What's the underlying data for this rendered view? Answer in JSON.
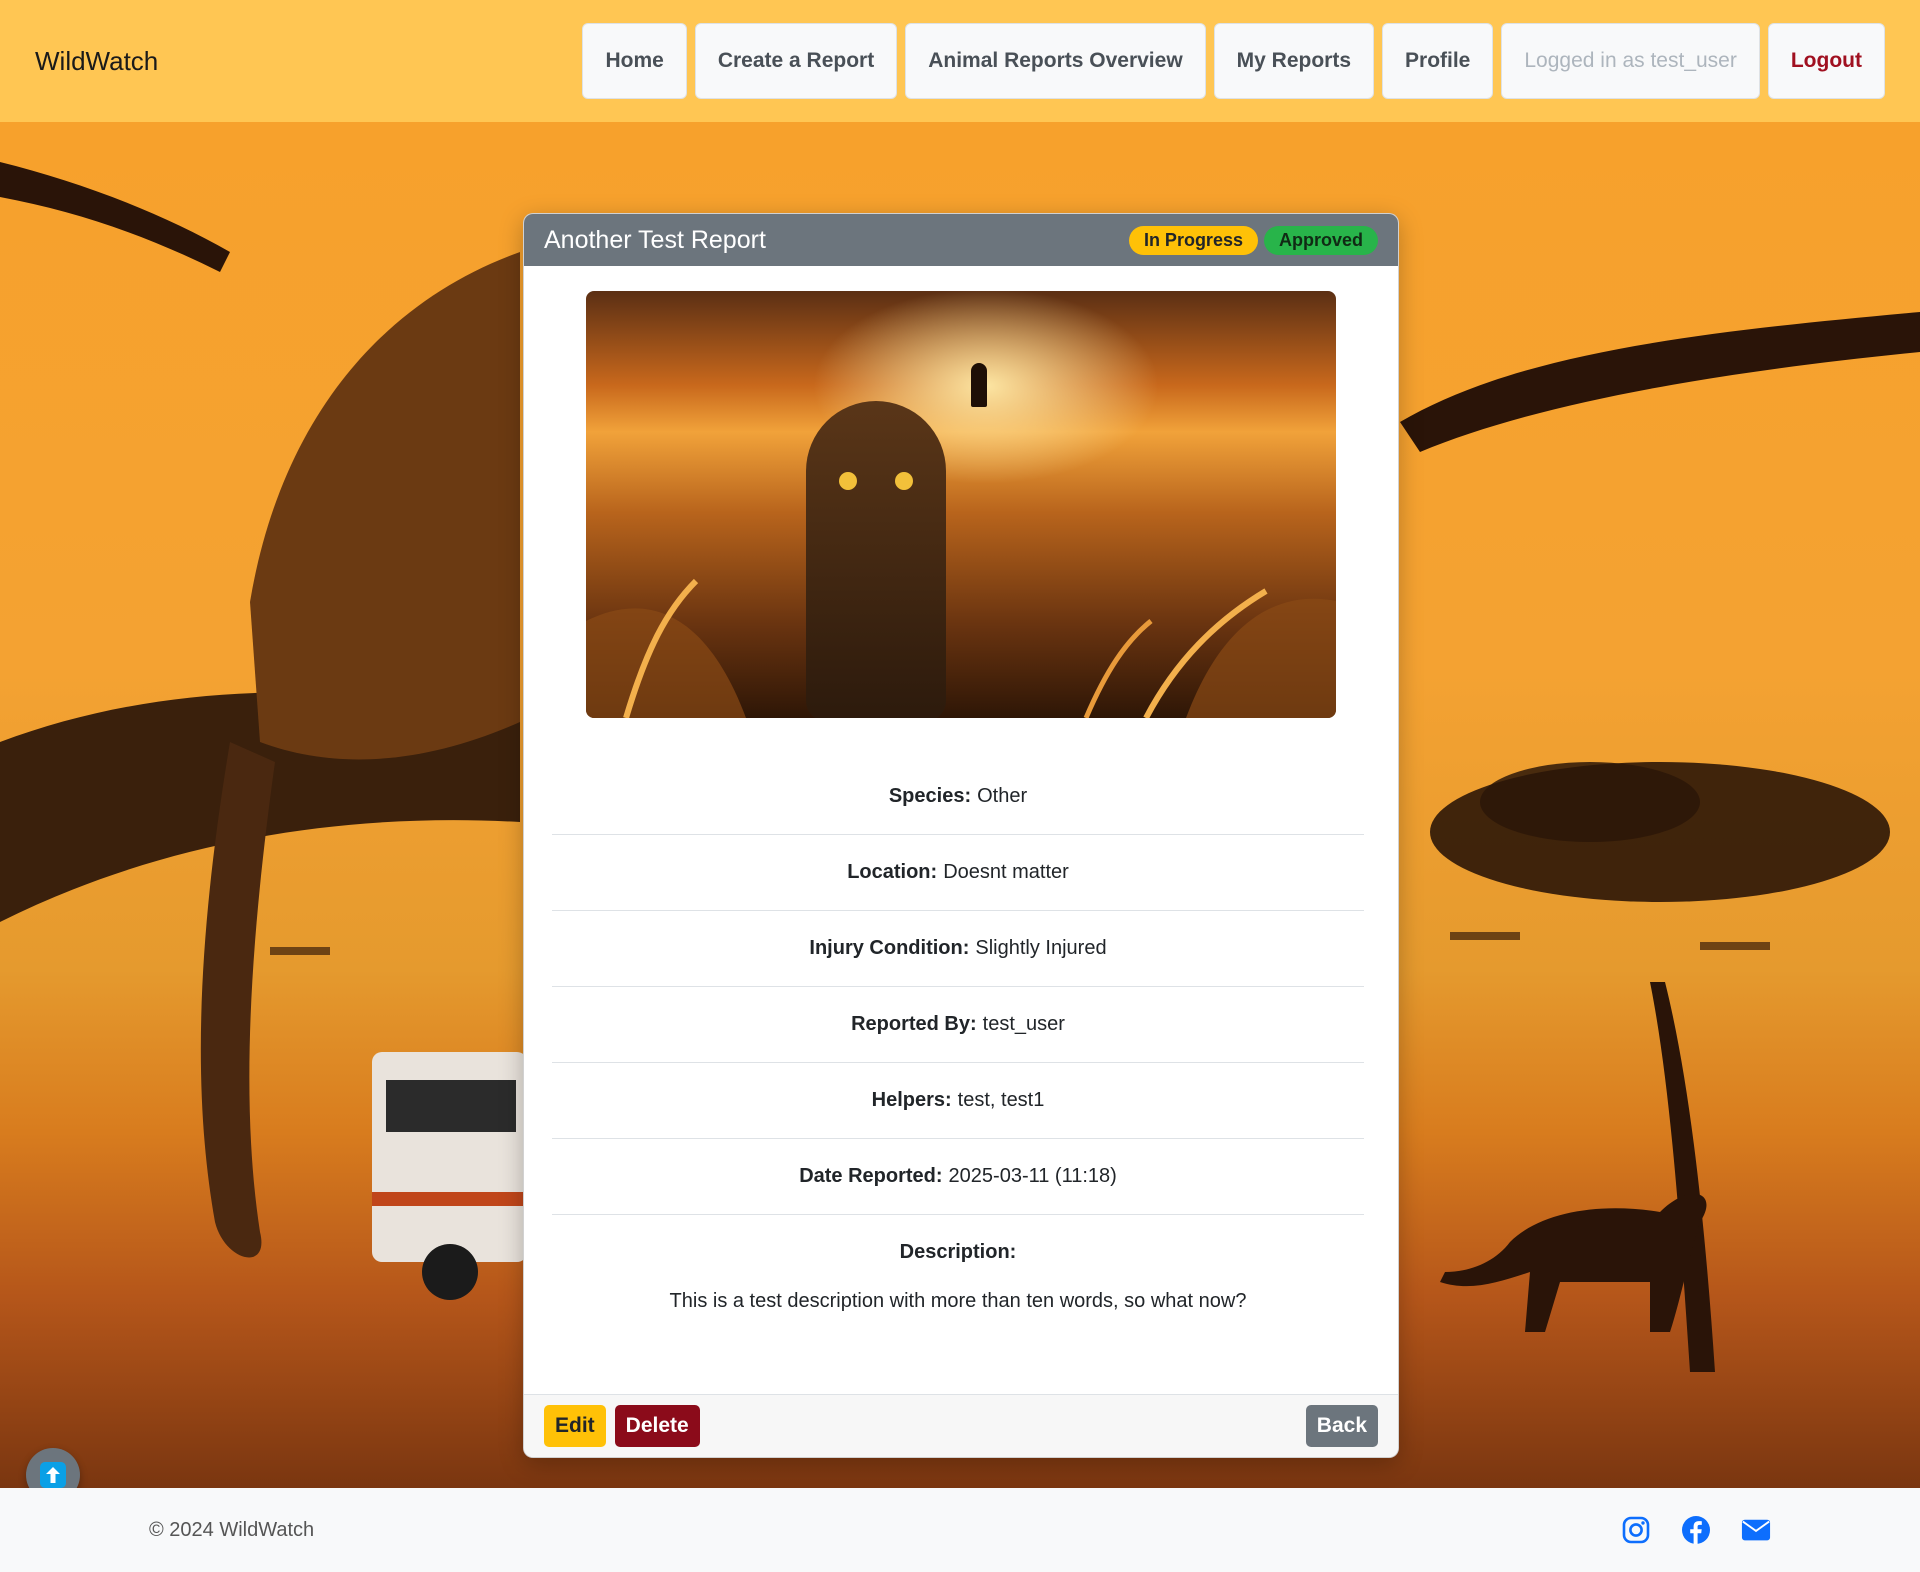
{
  "navbar": {
    "brand": "WildWatch",
    "links": {
      "home": "Home",
      "create": "Create a Report",
      "overview": "Animal Reports Overview",
      "my_reports": "My Reports",
      "profile": "Profile",
      "logged_in": "Logged in as test_user",
      "logout": "Logout"
    }
  },
  "report": {
    "title": "Another Test Report",
    "status_badges": [
      "In Progress",
      "Approved"
    ],
    "fields": {
      "species": {
        "label": "Species:",
        "value": "Other"
      },
      "location": {
        "label": "Location:",
        "value": "Doesnt matter"
      },
      "injury": {
        "label": "Injury Condition:",
        "value": "Slightly Injured"
      },
      "reported_by": {
        "label": "Reported By:",
        "value": "test_user"
      },
      "helpers": {
        "label": "Helpers:",
        "value": "test, test1"
      },
      "date": {
        "label": "Date Reported:",
        "value": "2025-03-11 (11:18)"
      }
    },
    "description_label": "Description:",
    "description": "This is a test description with more than ten words, so what now?",
    "actions": {
      "edit": "Edit",
      "delete": "Delete",
      "back": "Back"
    }
  },
  "footer": {
    "copyright": "© 2024 WildWatch",
    "socials": [
      "instagram-icon",
      "facebook-icon",
      "envelope-icon"
    ]
  },
  "colors": {
    "navbar": "#ffc653",
    "card_header": "#6c757d",
    "badge_in_progress": "#ffc107",
    "badge_approved": "#28b44a",
    "delete": "#8b0b1a",
    "social": "#0d6efd"
  }
}
